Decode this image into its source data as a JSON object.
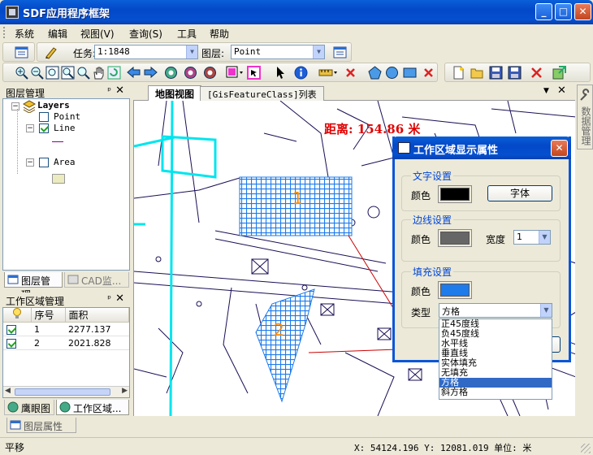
{
  "window": {
    "title": "SDF应用程序框架"
  },
  "menu": [
    "系统",
    "编辑",
    "视图(V)",
    "查询(S)",
    "工具",
    "帮助"
  ],
  "toolbar1": {
    "task_label": "任务:",
    "task_value": "1:1848",
    "layer_label": "图层:",
    "layer_value": "Point"
  },
  "layer_panel": {
    "title": "图层管理",
    "root": "Layers",
    "layers": [
      "Point",
      "Line",
      "Area"
    ],
    "line_checked": true
  },
  "left_tabs": {
    "layers": "图层管理",
    "cad": "CAD监..."
  },
  "work_panel": {
    "title": "工作区域管理",
    "columns": [
      "",
      "序号",
      "面积"
    ],
    "rows": [
      {
        "id": "1",
        "area": "2277.137",
        "checked": true
      },
      {
        "id": "2",
        "area": "2021.828",
        "checked": true
      }
    ]
  },
  "bottom_tabs": {
    "eagle": "鹰眼图",
    "work": "工作区域..."
  },
  "doc_tabs": {
    "map": "地图视图",
    "list": "[GisFeatureClass]列表"
  },
  "side_tab": "数据管理",
  "map": {
    "distance": "距离: 154.86 米",
    "label1": "1",
    "label2": "2"
  },
  "dialog": {
    "title": "工作区域显示属性",
    "text_group": "文字设置",
    "border_group": "边线设置",
    "fill_group": "填充设置",
    "color_label": "颜色",
    "font_button": "字体",
    "width_label": "宽度",
    "width_value": "1",
    "type_label": "类型",
    "type_value": "方格",
    "options": [
      "正45度线",
      "负45度线",
      "水平线",
      "垂直线",
      "实体填充",
      "无填充",
      "方格",
      "斜方格"
    ],
    "selected_option": "方格",
    "text_color": "#000000",
    "border_color": "#666666",
    "fill_color": "#1e7bea"
  },
  "panelbar": {
    "tab": "图层属性"
  },
  "status": {
    "left": "平移",
    "coords": "X: 54124.196 Y: 12081.019 单位: 米"
  }
}
